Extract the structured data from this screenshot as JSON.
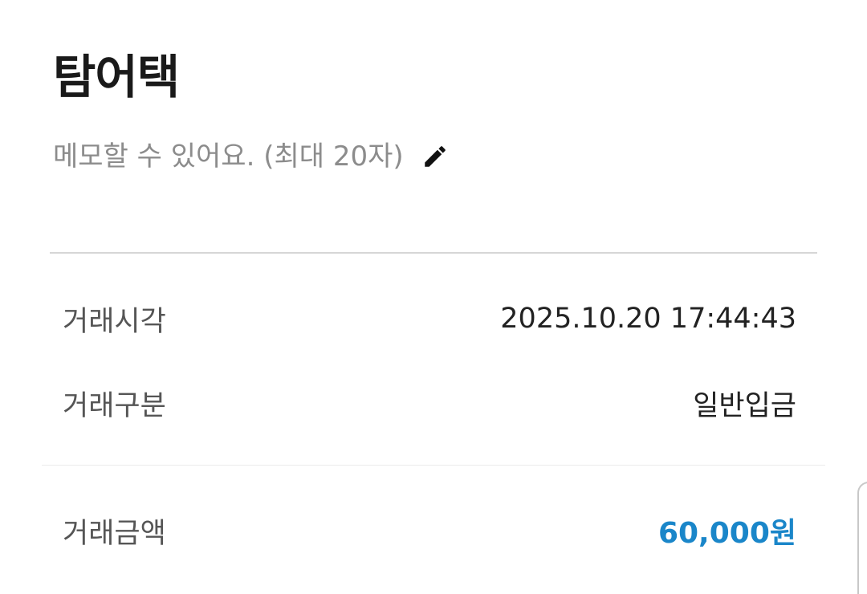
{
  "header": {
    "title": "탐어택"
  },
  "memo": {
    "placeholder": "메모할 수 있어요. (최대 20자)",
    "edit_icon": "pencil-icon"
  },
  "details": [
    {
      "label": "거래시각",
      "value": "2025.10.20 17:44:43"
    },
    {
      "label": "거래구분",
      "value": "일반입금"
    }
  ],
  "amount": {
    "label": "거래금액",
    "value": "60,000원",
    "color": "#1a86c9"
  }
}
